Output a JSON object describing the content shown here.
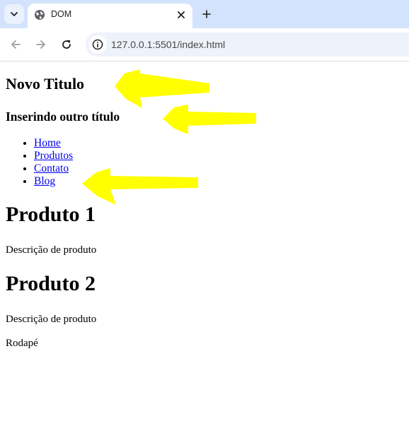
{
  "browser": {
    "tab_title": "DOM",
    "url": "127.0.0.1:5501/index.html"
  },
  "page": {
    "title": "Novo Titulo",
    "subtitle": "Inserindo outro título",
    "nav_links": [
      "Home",
      "Produtos",
      "Contato",
      "Blog"
    ],
    "products": [
      {
        "name": "Produto 1",
        "description": "Descrição de produto"
      },
      {
        "name": "Produto 2",
        "description": "Descrição de produto"
      }
    ],
    "footer": "Rodapé"
  },
  "annotation_color": "#ffff00"
}
